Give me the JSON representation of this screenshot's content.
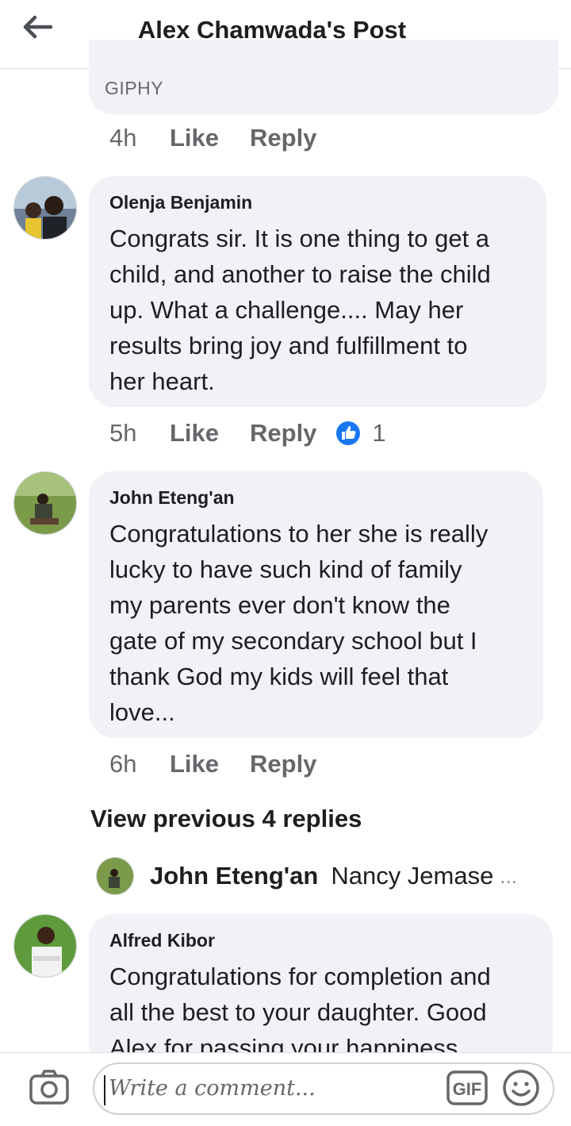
{
  "header": {
    "title": "Alex Chamwada's Post",
    "back_icon": "arrow-left-icon"
  },
  "giphy": {
    "label": "GIPHY",
    "time": "4h",
    "like": "Like",
    "reply": "Reply"
  },
  "comments": [
    {
      "author": "Olenja Benjamin",
      "lines": [
        "Congrats sir. It is one thing to get a",
        "child, and another to raise the child",
        "up. What a challenge.... May her",
        "results bring joy and fulfillment to",
        "her heart."
      ],
      "time": "5h",
      "like": "Like",
      "reply": "Reply",
      "reaction_icon": "thumbs-up-icon",
      "reaction_count": "1"
    },
    {
      "author": "John Eteng'an",
      "lines": [
        "Congratulations to her she is really",
        "lucky to have such kind of family",
        "my parents ever don't know the",
        "gate of my secondary school but I",
        "thank God my kids will feel that",
        "love..."
      ],
      "time": "6h",
      "like": "Like",
      "reply": "Reply"
    },
    {
      "author": "Alfred Kibor",
      "lines": [
        "Congratulations for completion and",
        "all the best to your daughter. Good",
        "Alex for passing your happiness"
      ]
    }
  ],
  "replies": {
    "view_previous": "View previous 4 replies",
    "preview_author": "John Eteng'an",
    "preview_text": "Nancy Jemase",
    "preview_ellipsis": "..."
  },
  "composer": {
    "placeholder": "Write a comment...",
    "gif_label": "GIF",
    "camera_icon": "camera-icon",
    "emoji_icon": "smiley-icon"
  },
  "colors": {
    "bubble": "#f0f2f5",
    "secondary_text": "#65676b",
    "like_blue": "#1877f2"
  }
}
